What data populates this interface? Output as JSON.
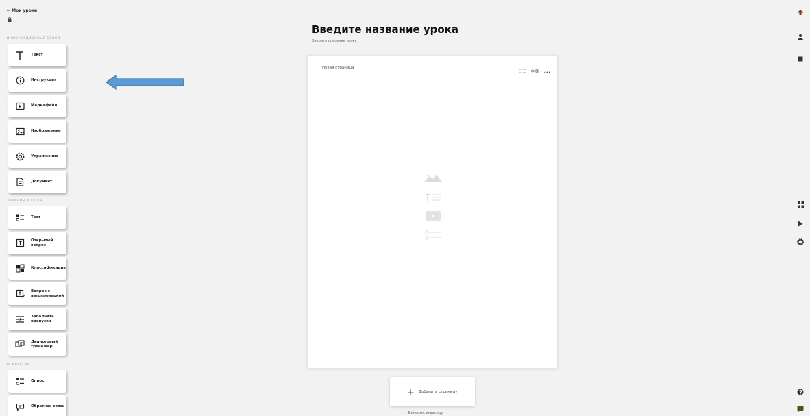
{
  "header": {
    "back_label": "← Мои уроки"
  },
  "sidebar": {
    "sections": [
      {
        "title": "информационные блоки"
      },
      {
        "title": "задания и тесты"
      },
      {
        "title": "рефлексия"
      }
    ],
    "info_blocks": [
      {
        "label": "Текст",
        "icon": "text-icon"
      },
      {
        "label": "Инструкция",
        "icon": "info-icon"
      },
      {
        "label": "Медиафайл",
        "icon": "media-icon"
      },
      {
        "label": "Изображение",
        "icon": "image-icon"
      },
      {
        "label": "Упражнение",
        "icon": "exercise-icon"
      },
      {
        "label": "Документ",
        "icon": "document-icon"
      }
    ],
    "tasks": [
      {
        "label": "Тест",
        "icon": "test-icon"
      },
      {
        "label": "Открытый вопрос",
        "icon": "open-question-icon"
      },
      {
        "label": "Классификация",
        "icon": "classification-icon"
      },
      {
        "label": "Вопрос с автопроверкой",
        "icon": "autocheck-icon"
      },
      {
        "label": "Заполнить пропуски",
        "icon": "fill-gaps-icon"
      },
      {
        "label": "Диалоговый тренажер",
        "icon": "dialog-trainer-icon"
      }
    ],
    "reflection": [
      {
        "label": "Опрос",
        "icon": "poll-icon"
      },
      {
        "label": "Обратная связь",
        "icon": "feedback-icon"
      }
    ]
  },
  "lesson": {
    "title": "Введите название урока",
    "description_placeholder": "Введите описание урока"
  },
  "page": {
    "name": "Новая страница"
  },
  "actions": {
    "add_page": "Добавить страницу",
    "below_label": "+ Вставить страницу"
  },
  "colors": {
    "arrow": "#5b9bd5",
    "arrow_border": "#3f76ab",
    "background": "#f2f2f2"
  }
}
